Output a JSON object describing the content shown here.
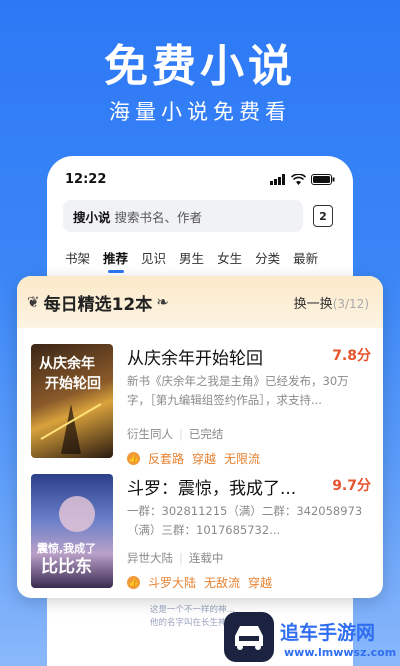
{
  "hero": {
    "title": "免费小说",
    "subtitle": "海量小说免费看"
  },
  "status": {
    "time": "12:22"
  },
  "search": {
    "brand": "搜小说",
    "placeholder": "搜索书名、作者",
    "tab_count": "2"
  },
  "nav": [
    "书架",
    "推荐",
    "见识",
    "男生",
    "女生",
    "分类",
    "最新"
  ],
  "card": {
    "title": "每日精选12本",
    "refresh_label": "换一换",
    "refresh_count": "(3/12)"
  },
  "books": [
    {
      "title": "从庆余年开始轮回",
      "score": "7.8分",
      "desc": "新书《庆余年之我是主角》已经发布，30万字，［第九编辑组签约作品］，求支持...",
      "genre": "衍生同人",
      "status": "已完结",
      "tags": [
        "反套路",
        "穿越",
        "无限流"
      ],
      "cover_title": "从庆余年开始轮回"
    },
    {
      "title": "斗罗：震惊，我成了...",
      "score": "9.7分",
      "desc": "一群：302811215（满）二群：342058973（满）三群：1017685732...",
      "genre": "异世大陆",
      "status": "连载中",
      "tags": [
        "斗罗大陆",
        "无敌流",
        "穿越"
      ],
      "cover_title": "震惊，我成了比比东"
    }
  ],
  "peek": {
    "line1": "这是一个不一样的神…",
    "line2": "他的名字叫在长生神…"
  },
  "watermark": {
    "brand": "追车手游网",
    "url": "www.lmwwsz.com"
  },
  "colors": {
    "brand_blue": "#2d78f5",
    "score_red": "#e7542f",
    "tag_orange": "#e7812f"
  }
}
